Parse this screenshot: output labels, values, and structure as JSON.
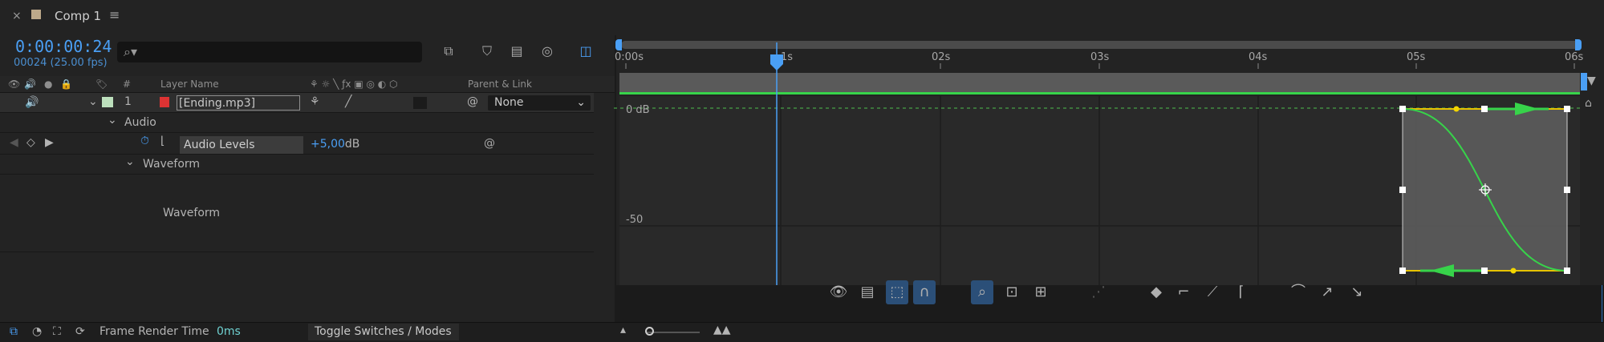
{
  "tab": {
    "close": "×",
    "title": "Comp 1",
    "menu": "≡"
  },
  "time": {
    "timecode": "0:00:00:24",
    "frames": "00024 (25.00 fps)"
  },
  "search": {
    "icon": "⌕▾",
    "value": ""
  },
  "columns": {
    "layer_name": "Layer Name",
    "parent_link": "Parent & Link",
    "hash": "#"
  },
  "layer": {
    "number": "1",
    "name": "[Ending.mp3]",
    "parent": "None"
  },
  "audio_group": {
    "label": "Audio"
  },
  "audio_levels": {
    "label": "Audio Levels",
    "value": "+5,00",
    "unit": "dB"
  },
  "waveform_group": {
    "label": "Waveform"
  },
  "waveform_body": {
    "label": "Waveform"
  },
  "ruler": {
    "labels": [
      "0:00s",
      "1s",
      "02s",
      "03s",
      "04s",
      "05s",
      "06s"
    ]
  },
  "graph": {
    "label_top": "0 dB",
    "label_mid": "-50"
  },
  "bottom": {
    "frame_render_label": "Frame Render Time",
    "frame_render_value": "0ms",
    "toggle_label": "Toggle Switches / Modes"
  },
  "colors": {
    "accent": "#4a9ff5",
    "curve": "#37d34a",
    "handle": "#f2d500"
  }
}
